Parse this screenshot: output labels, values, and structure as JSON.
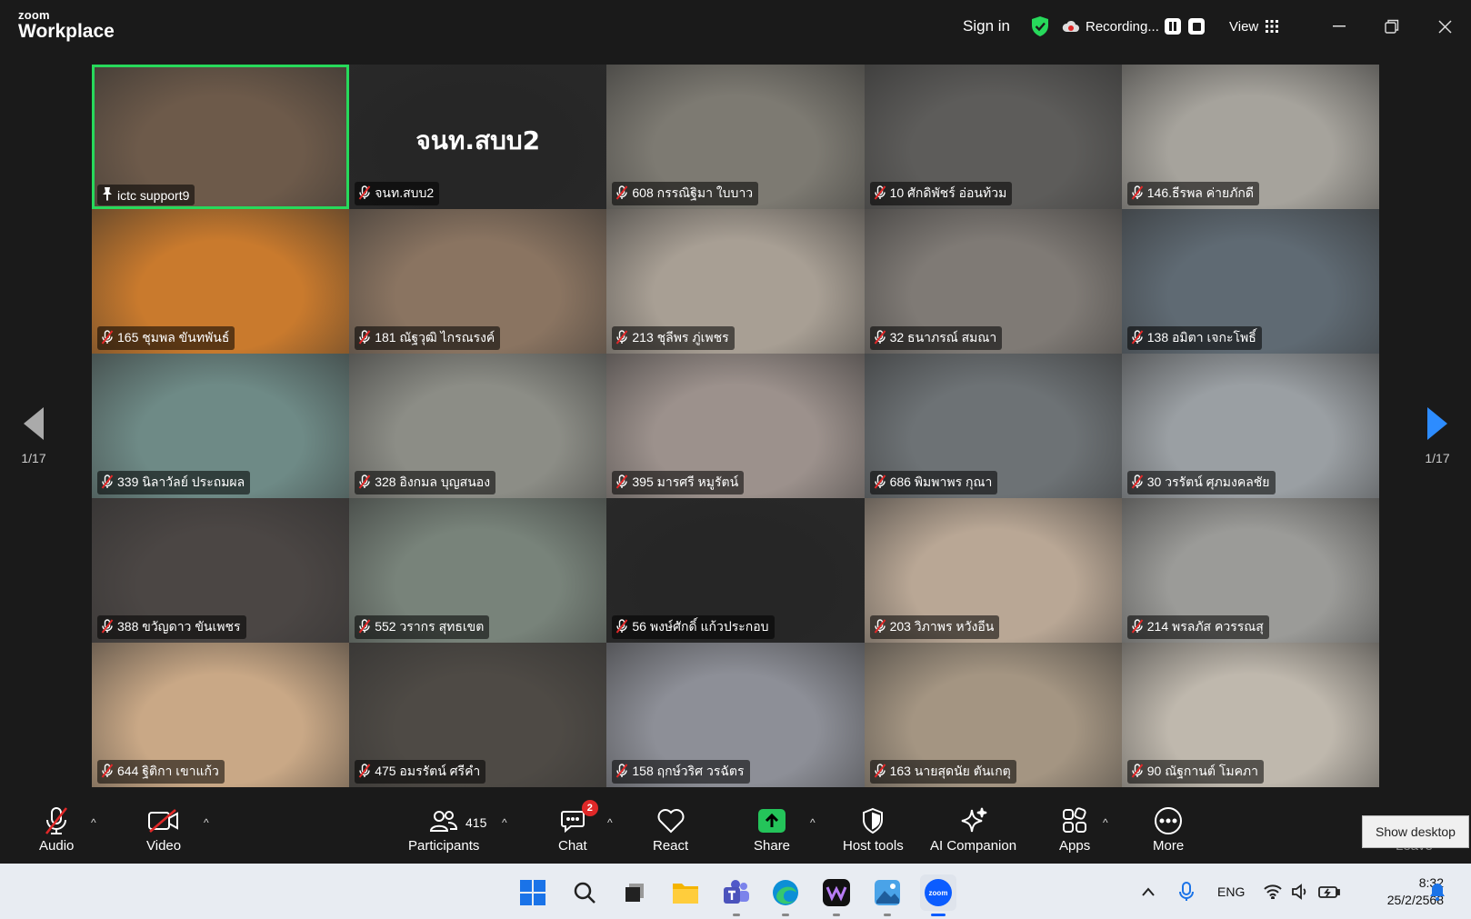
{
  "app": {
    "brand_small": "zoom",
    "brand_big": "Workplace"
  },
  "titlebar": {
    "sign_in": "Sign in",
    "recording": "Recording...",
    "view": "View"
  },
  "pager": {
    "left": "1/17",
    "right": "1/17"
  },
  "tiles": [
    {
      "name": "ictc support9",
      "pinned": true,
      "bg": "#6d5a4a"
    },
    {
      "name": "จนท.สบบ2",
      "center": "จนท.สบบ2",
      "bg": "#262626"
    },
    {
      "name": "608 กรรณิฐิมา ใบบาว",
      "bg": "#7d7a72"
    },
    {
      "name": "10 ศักดิพัชร์ อ่อนท้วม",
      "bg": "#5d5c5a"
    },
    {
      "name": "146.ธีรพล ค่ายภักดี",
      "bg": "#a6a39c"
    },
    {
      "name": "165 ชุมพล ขันทพันธ์",
      "bg": "#c97a2d"
    },
    {
      "name": "181 ณัฐวุฒิ  ไกรณรงค์",
      "bg": "#8a7461"
    },
    {
      "name": "213 ชุลีพร ภู่เพชร",
      "bg": "#a89f94"
    },
    {
      "name": "32 ธนาภรณ์ สมณา",
      "bg": "#7f7a75"
    },
    {
      "name": "138 อมิตา เจกะโพธิ์",
      "bg": "#5f6a73"
    },
    {
      "name": "339 นิลาวัลย์ ประถมผล",
      "bg": "#6e8a86"
    },
    {
      "name": "328 อิงกมล บุญสนอง",
      "bg": "#8c8d86"
    },
    {
      "name": "395 มารศรี หมูรัตน์",
      "bg": "#9c918c"
    },
    {
      "name": "686 พิมพาพร กุณา",
      "bg": "#6d7275"
    },
    {
      "name": "30 วรรัตน์ ศุภมงคลชัย",
      "bg": "#9a9fa3"
    },
    {
      "name": "388 ขวัญดาว ขันเพชร",
      "bg": "#4b4644"
    },
    {
      "name": "552 วรากร สุทธเขต",
      "bg": "#78837a"
    },
    {
      "name": "56 พงษ์ศักดิ์ แก้วประกอบ",
      "bg": "#262626"
    },
    {
      "name": "203 วิภาพร หวังอีน",
      "bg": "#b9a795"
    },
    {
      "name": "214 พรลภัส ควรรณสุ",
      "bg": "#9b9b98"
    },
    {
      "name": "644 ฐิติกา เขาแก้ว",
      "bg": "#c9a886"
    },
    {
      "name": "475 อมรรัตน์ ศรีคำ",
      "bg": "#4e4a45"
    },
    {
      "name": "158 ฤกษ์วริศ วรฉัตร",
      "bg": "#8d8f97"
    },
    {
      "name": "163 นายสุดนัย ตันเกตุ",
      "bg": "#a49582"
    },
    {
      "name": "90 ณัฐกานต์ โมคภา",
      "bg": "#bfb8ad"
    }
  ],
  "controls": {
    "audio": "Audio",
    "video": "Video",
    "participants": "Participants",
    "participants_count": "415",
    "chat": "Chat",
    "chat_badge": "2",
    "react": "React",
    "share": "Share",
    "host_tools": "Host tools",
    "ai_companion": "AI Companion",
    "apps": "Apps",
    "more": "More",
    "leave": "Leave",
    "tooltip": "Show desktop"
  },
  "taskbar": {
    "lang": "ENG",
    "time": "8:32",
    "date": "25/2/2568"
  },
  "colors": {
    "active_border": "#27d95b",
    "accent": "#2d8cff",
    "share_green": "#24c45a",
    "badge_red": "#e02828"
  }
}
